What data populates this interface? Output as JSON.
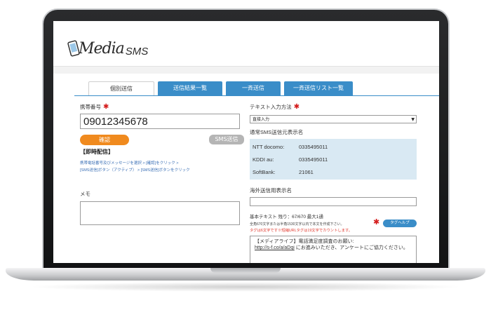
{
  "app": {
    "logo_text": "Media",
    "logo_sub": "SMS"
  },
  "tabs": [
    {
      "label": "個別送信"
    },
    {
      "label": "送信結果一覧"
    },
    {
      "label": "一斉送信"
    },
    {
      "label": "一斉送信リスト一覧"
    }
  ],
  "left": {
    "phone_label": "携帯番号",
    "required_mark": "✱",
    "phone_value": "09012345678",
    "confirm_button": "確認",
    "sms_button": "SMS送信",
    "instant_title": "【即時配信】",
    "note_line1": "携帯電話番号及びメッセージを選択 > [確認]をクリック >",
    "note_line2": "[SMS送信]ボタン（アクティブ） > [SMS送信]ボタンをクリック",
    "memo_label": "メモ"
  },
  "right": {
    "method_label": "テキスト入力方法",
    "method_value": "直接入力",
    "sender_label": "通常SMS送信元表示名",
    "carriers": [
      {
        "name": "NTT docomo:",
        "value": "0335495011"
      },
      {
        "name": "KDDI au:",
        "value": "0335495011"
      },
      {
        "name": "SoftBank:",
        "value": "21061"
      }
    ],
    "overseas_label": "海外送信用表示名",
    "text_count": "基本テキスト 残り：67/670 最大1通",
    "text_note": "全角670文字または半角1530文字以内で本文を作成下さい。",
    "tag_note": "タグは6文字です※短縮URLタグは19文字でカウントします。",
    "help_button": "タグヘルプ",
    "message_line1": "【メディアライフ】電話満足度調査のお願い:",
    "message_link": "http://s-f.co/a/aDqi",
    "message_line2": "にお進みいただき、アンケートにご協力ください。"
  }
}
